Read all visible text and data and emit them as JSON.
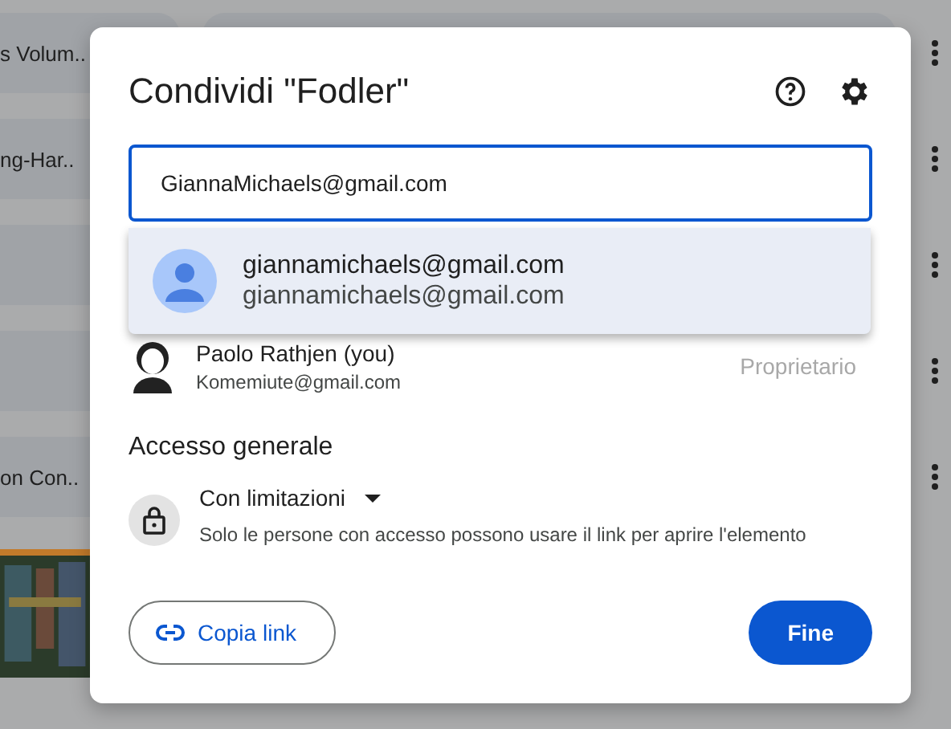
{
  "background": {
    "cards": [
      {
        "kind": "file",
        "label": "s Volum.."
      },
      {
        "kind": "file",
        "label": "ng-Har.."
      },
      {
        "kind": "blank"
      },
      {
        "kind": "blank"
      },
      {
        "kind": "file",
        "label": "on Con.."
      }
    ]
  },
  "dialog": {
    "title": "Condividi \"Fodler\"",
    "input": {
      "value": "GiannaMichaels@gmail.com",
      "focused": true
    },
    "suggestion": {
      "name": "giannamichaels@gmail.com",
      "email": "giannamichaels@gmail.com"
    },
    "people": [
      {
        "name": "Paolo Rathjen (you)",
        "email": "Komemiute@gmail.com",
        "role": "Proprietario"
      }
    ],
    "general_access": {
      "heading": "Accesso generale",
      "option": "Con limitazioni",
      "description": "Solo le persone con accesso possono usare il link per aprire l'elemento"
    },
    "buttons": [
      {
        "label": "Copia link",
        "kind": "outlined"
      },
      {
        "label": "Fine",
        "kind": "filled"
      }
    ]
  }
}
